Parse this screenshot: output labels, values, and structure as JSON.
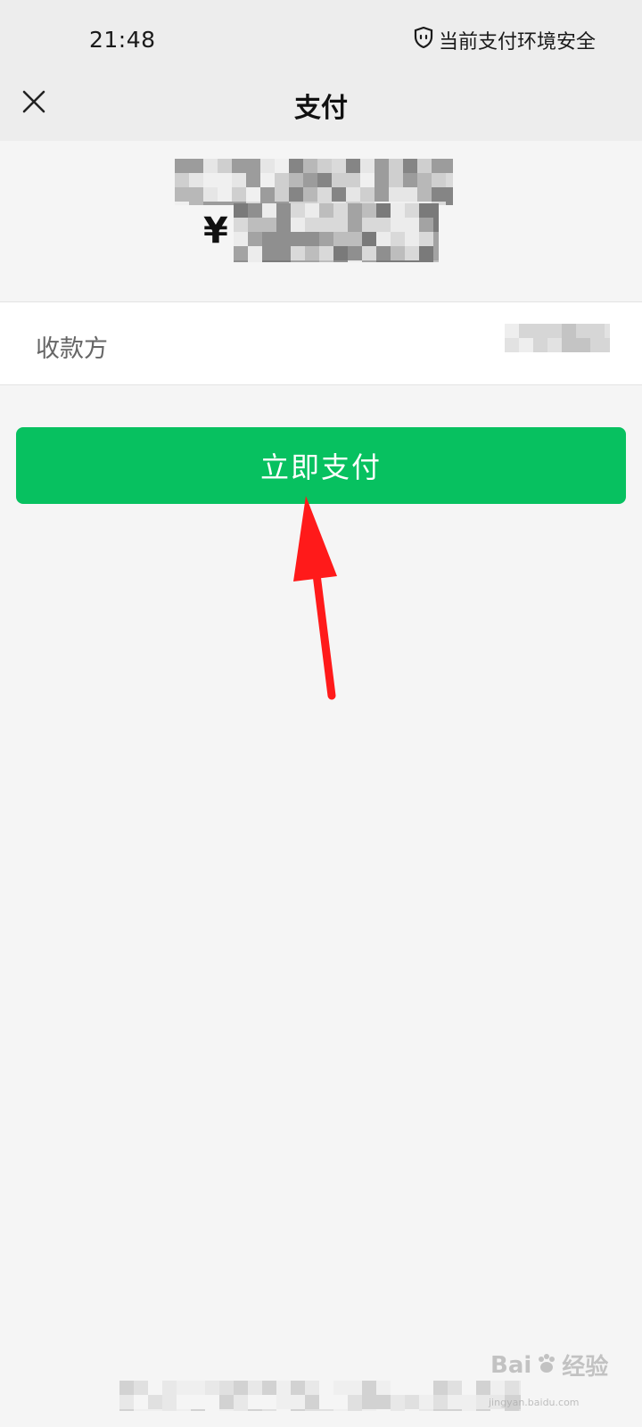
{
  "status_bar": {
    "time": "21:48",
    "security_text": "当前支付环境安全",
    "security_icon": "shield-icon"
  },
  "nav": {
    "title": "支付",
    "close_icon": "close-icon"
  },
  "amount": {
    "currency_symbol": "¥"
  },
  "payee": {
    "label": "收款方"
  },
  "actions": {
    "pay_label": "立即支付"
  },
  "annotation": {
    "arrow_color": "#ff0000"
  },
  "watermark": {
    "brand": "Bai",
    "brand2": "经验",
    "url": "jingyan.baidu.com"
  },
  "colors": {
    "primary_green": "#07c160",
    "header_bg": "#ededed",
    "page_bg": "#f5f5f5"
  }
}
